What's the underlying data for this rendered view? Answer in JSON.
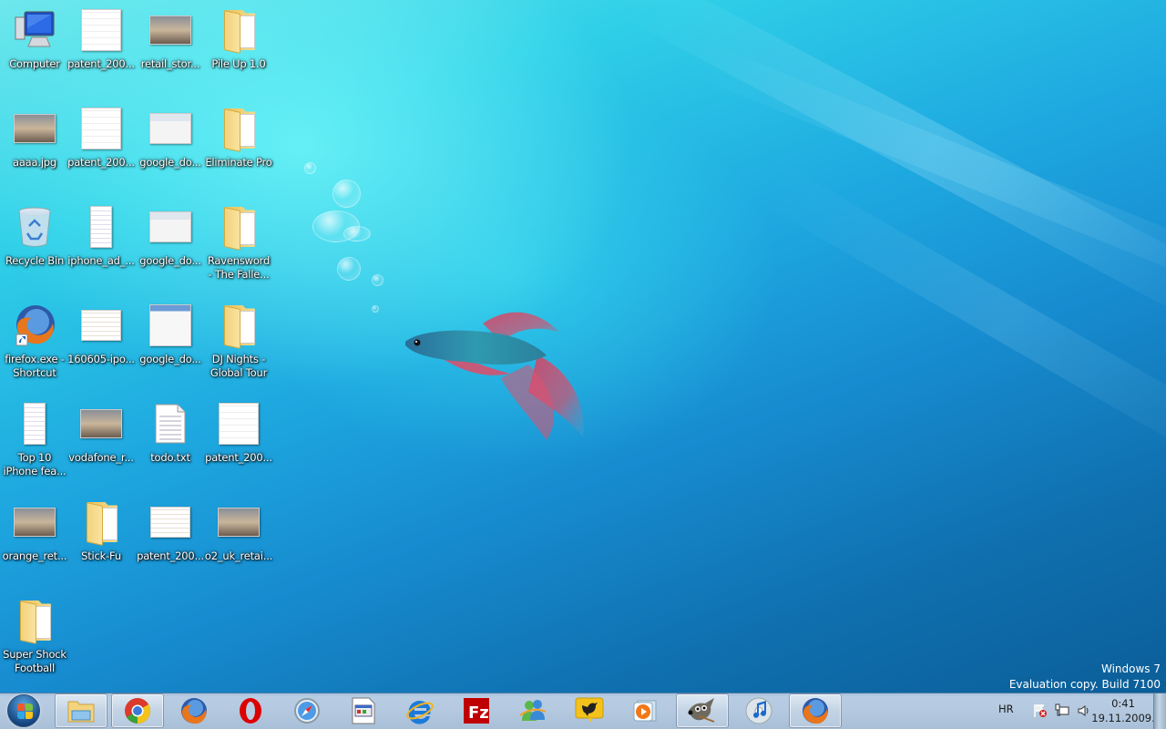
{
  "desktop": {
    "icons": [
      {
        "label": "Computer",
        "type": "computer"
      },
      {
        "label": "patent_200...",
        "type": "image-diagram"
      },
      {
        "label": "retail_stor...",
        "type": "image-photo"
      },
      {
        "label": "Pile Up 1.0",
        "type": "folder"
      },
      {
        "label": "aaaa.jpg",
        "type": "image-photo"
      },
      {
        "label": "patent_200...",
        "type": "image-diagram"
      },
      {
        "label": "google_do...",
        "type": "image-screenshot"
      },
      {
        "label": "Eliminate Pro",
        "type": "folder"
      },
      {
        "label": "Recycle Bin",
        "type": "recycle-bin"
      },
      {
        "label": "iphone_ad_...",
        "type": "image-document"
      },
      {
        "label": "google_do...",
        "type": "image-screenshot"
      },
      {
        "label": "Ravensword\n- The Falle...",
        "type": "folder"
      },
      {
        "label": "firefox.exe -\nShortcut",
        "type": "firefox-shortcut"
      },
      {
        "label": "160605-ipo...",
        "type": "image-table"
      },
      {
        "label": "google_do...",
        "type": "image-menu"
      },
      {
        "label": "DJ Nights -\nGlobal Tour",
        "type": "folder"
      },
      {
        "label": "Top 10\niPhone fea...",
        "type": "image-document"
      },
      {
        "label": "vodafone_r...",
        "type": "image-photo"
      },
      {
        "label": "todo.txt",
        "type": "text-file"
      },
      {
        "label": "patent_200...",
        "type": "image-diagram"
      },
      {
        "label": "orange_ret...",
        "type": "image-photo"
      },
      {
        "label": "Stick-Fu",
        "type": "folder"
      },
      {
        "label": "patent_200...",
        "type": "image-table"
      },
      {
        "label": "o2_uk_retai...",
        "type": "image-photo"
      },
      {
        "label": "Super Shock\nFootball",
        "type": "folder"
      }
    ],
    "watermark": {
      "line1": "Windows 7",
      "line2": "Evaluation copy. Build 7100"
    }
  },
  "taskbar": {
    "start_label": "Start",
    "items": [
      {
        "name": "windows-explorer",
        "open": true
      },
      {
        "name": "google-chrome",
        "open": true
      },
      {
        "name": "firefox",
        "open": false
      },
      {
        "name": "opera",
        "open": false
      },
      {
        "name": "safari",
        "open": false
      },
      {
        "name": "application-window",
        "open": false
      },
      {
        "name": "internet-explorer",
        "open": false
      },
      {
        "name": "filezilla",
        "open": false
      },
      {
        "name": "windows-live-messenger",
        "open": false
      },
      {
        "name": "twitter-client",
        "open": false
      },
      {
        "name": "windows-media-player",
        "open": false
      },
      {
        "name": "gimp",
        "open": true
      },
      {
        "name": "itunes",
        "open": false
      },
      {
        "name": "firefox",
        "open": true
      }
    ],
    "tray": {
      "language": "HR",
      "time": "0:41",
      "date": "19.11.2009."
    }
  },
  "colors": {
    "taskbar_bg": "#b4c9df",
    "label_text": "#ffffff",
    "tray_text": "#1a1a1a"
  }
}
